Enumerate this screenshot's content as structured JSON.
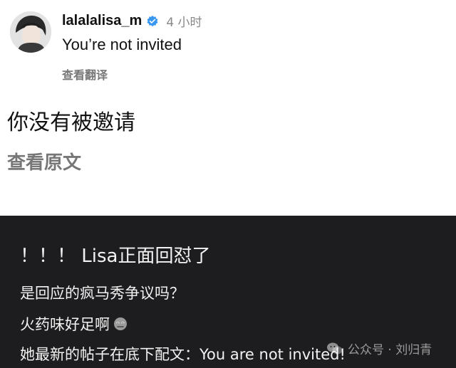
{
  "post": {
    "username": "lalalalisa_m",
    "time": "4 小时",
    "text": "You’re not invited",
    "see_translation": "查看翻译",
    "translated_text": "你没有被邀请",
    "see_original": "查看原文"
  },
  "commentary": {
    "line1": "！！！ Lisa正面回怼了",
    "line2": "是回应的疯马秀争议吗？",
    "line3": "火药味好足啊",
    "line4": "她最新的帖子在底下配文：You are not invited!"
  },
  "watermark": {
    "text": "公众号 · 刘归青"
  },
  "colors": {
    "verified_blue": "#3897f0",
    "dark_panel": "#1d1d1f",
    "muted_text": "#777777"
  },
  "icons": {
    "verified": "verified-badge-icon",
    "emoji": "unamused-face-emoji",
    "watermark": "wechat-account-icon"
  }
}
